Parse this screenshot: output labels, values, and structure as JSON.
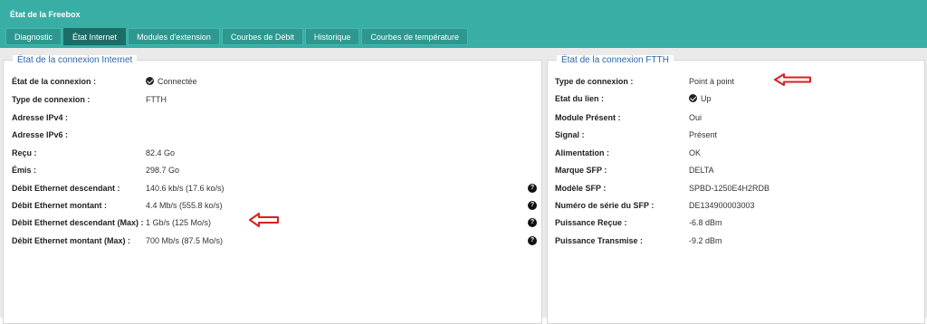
{
  "header": {
    "title": "État de la Freebox",
    "tabs": [
      {
        "label": "Diagnostic"
      },
      {
        "label": "État Internet",
        "active": true
      },
      {
        "label": "Modules d'extension"
      },
      {
        "label": "Courbes de Débit"
      },
      {
        "label": "Historique"
      },
      {
        "label": "Courbes de température"
      }
    ]
  },
  "internet_panel": {
    "title": "État de la connexion Internet",
    "rows": [
      {
        "label": "État de la connexion :",
        "value": "Connectée",
        "icon": "check-circle-icon"
      },
      {
        "label": "Type de connexion :",
        "value": "FTTH"
      },
      {
        "label": "Adresse IPv4 :",
        "value": ""
      },
      {
        "label": "Adresse IPv6 :",
        "value": ""
      },
      {
        "label": "Reçu :",
        "value": "82.4 Go"
      },
      {
        "label": "Émis :",
        "value": "298.7 Go"
      },
      {
        "label": "Débit Ethernet descendant :",
        "value": "140.6 kb/s (17.6 ko/s)",
        "help": true
      },
      {
        "label": "Débit Ethernet montant :",
        "value": "4.4 Mb/s (555.8 ko/s)",
        "help": true
      },
      {
        "label": "Débit Ethernet descendant (Max) :",
        "value": "1 Gb/s (125 Mo/s)",
        "help": true
      },
      {
        "label": "Débit Ethernet montant (Max) :",
        "value": "700 Mb/s (87.5 Mo/s)",
        "help": true
      }
    ]
  },
  "ftth_panel": {
    "title": "État de la connexion FTTH",
    "rows": [
      {
        "label": "Type de connexion :",
        "value": "Point à point"
      },
      {
        "label": "Etat du lien :",
        "value": "Up",
        "icon": "check-circle-icon"
      },
      {
        "label": "Module Présent :",
        "value": "Oui"
      },
      {
        "label": "Signal :",
        "value": "Présent"
      },
      {
        "label": "Alimentation :",
        "value": "OK"
      },
      {
        "label": "Marque SFP :",
        "value": "DELTA"
      },
      {
        "label": "Modèle SFP :",
        "value": "SPBD-1250E4H2RDB"
      },
      {
        "label": "Numéro de série du SFP :",
        "value": "DE134900003003"
      },
      {
        "label": "Puissance Reçue :",
        "value": "-6.8 dBm"
      },
      {
        "label": "Puissance Transmise :",
        "value": "-9.2 dBm"
      }
    ]
  },
  "help_icon_glyph": "?",
  "colors": {
    "header_bg": "#38aea4",
    "active_tab": "#1c6d68",
    "panel_title": "#2c65a8",
    "annotation_arrow": "#d92020"
  }
}
